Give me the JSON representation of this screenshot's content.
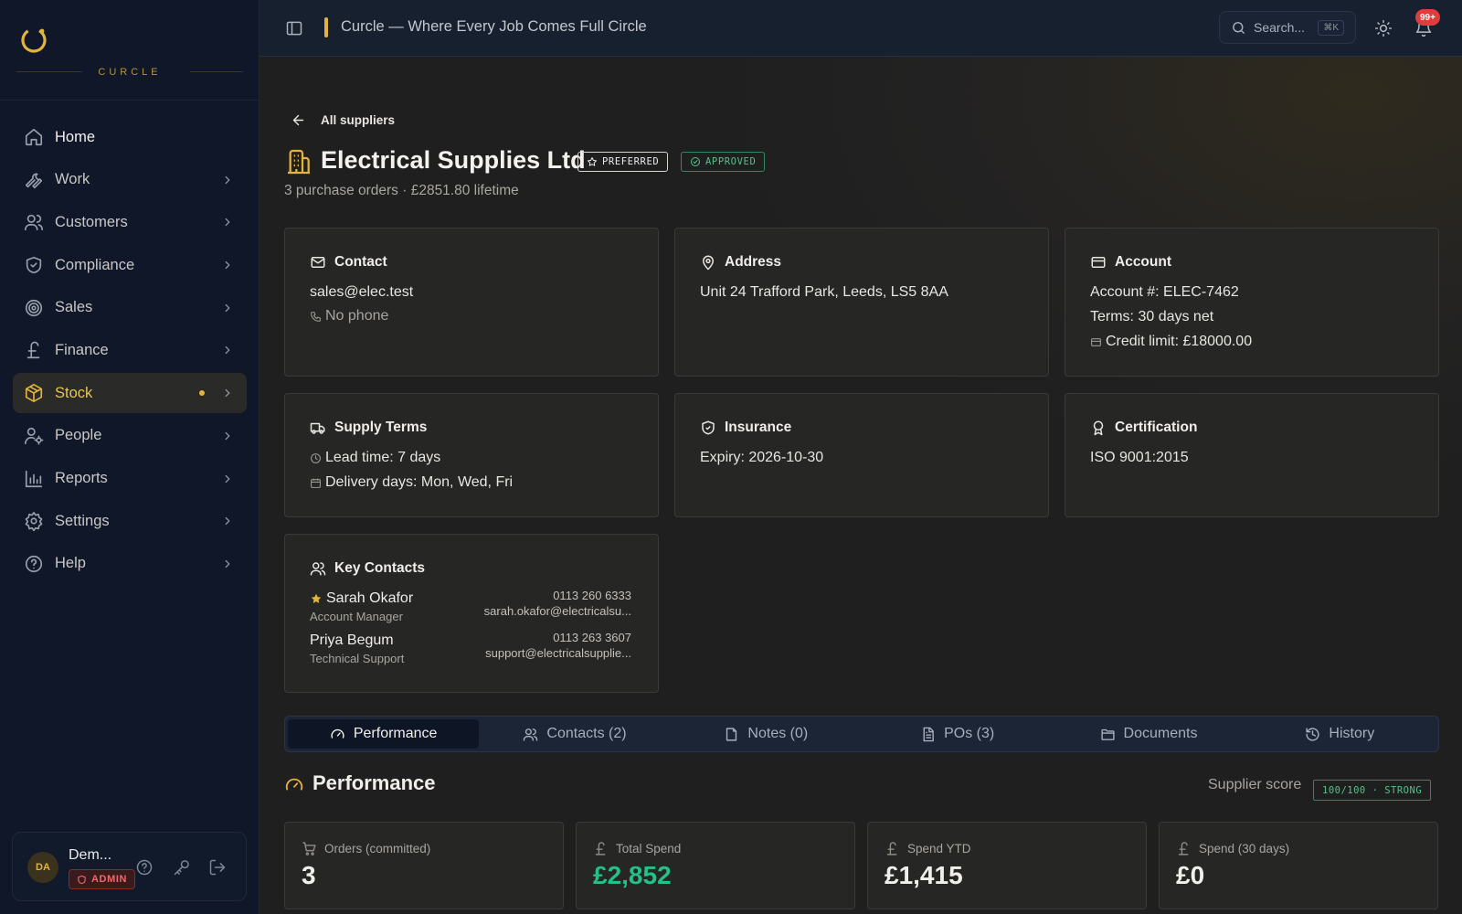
{
  "app": {
    "wordmark": "CURCLE",
    "topbar_title": "Curcle — Where Every Job Comes Full Circle",
    "search_placeholder": "Search...",
    "search_shortcut": "⌘K",
    "notification_count": "99+",
    "accent_color": "#e2b43c"
  },
  "sidebar": {
    "items": [
      {
        "label": "Home",
        "icon": "home-icon"
      },
      {
        "label": "Work",
        "icon": "wrench-icon"
      },
      {
        "label": "Customers",
        "icon": "users-icon"
      },
      {
        "label": "Compliance",
        "icon": "shield-icon"
      },
      {
        "label": "Sales",
        "icon": "target-icon"
      },
      {
        "label": "Finance",
        "icon": "pound-icon"
      },
      {
        "label": "Stock",
        "icon": "box-icon",
        "active": true
      },
      {
        "label": "People",
        "icon": "person-cog-icon"
      },
      {
        "label": "Reports",
        "icon": "bar-chart-icon"
      },
      {
        "label": "Settings",
        "icon": "gear-icon"
      },
      {
        "label": "Help",
        "icon": "help-circle-icon"
      }
    ]
  },
  "user": {
    "initials": "DA",
    "name": "Dem...",
    "role": "ADMIN"
  },
  "page": {
    "back_label": "All suppliers",
    "title": "Electrical Supplies Ltd",
    "badge_preferred": "PREFERRED",
    "badge_approved": "APPROVED",
    "subtitle": "3 purchase orders · £2851.80 lifetime"
  },
  "cards": {
    "contact": {
      "title": "Contact",
      "email": "sales@elec.test",
      "phone": "No phone"
    },
    "address": {
      "title": "Address",
      "value": "Unit 24 Trafford Park, Leeds, LS5 8AA"
    },
    "account": {
      "title": "Account",
      "number": "Account #: ELEC-7462",
      "terms": "Terms: 30 days net",
      "credit": "Credit limit: £18000.00"
    },
    "supply": {
      "title": "Supply Terms",
      "lead": "Lead time: 7 days",
      "delivery": "Delivery days: Mon, Wed, Fri"
    },
    "insurance": {
      "title": "Insurance",
      "expiry": "Expiry: 2026-10-30"
    },
    "certification": {
      "title": "Certification",
      "value": "ISO 9001:2015"
    },
    "key_contacts": {
      "title": "Key Contacts",
      "people": [
        {
          "name": "Sarah Okafor",
          "role": "Account Manager",
          "phone": "0113 260 6333",
          "email": "sarah.okafor@electricalsu...",
          "primary": true
        },
        {
          "name": "Priya Begum",
          "role": "Technical Support",
          "phone": "0113 263 3607",
          "email": "support@electricalsupplie...",
          "primary": false
        }
      ]
    }
  },
  "tabs": [
    {
      "label": "Performance",
      "icon": "gauge-icon",
      "active": true
    },
    {
      "label": "Contacts (2)",
      "icon": "users-icon"
    },
    {
      "label": "Notes (0)",
      "icon": "note-icon"
    },
    {
      "label": "POs (3)",
      "icon": "document-icon"
    },
    {
      "label": "Documents",
      "icon": "folder-icon"
    },
    {
      "label": "History",
      "icon": "history-icon"
    }
  ],
  "performance": {
    "title": "Performance",
    "score_label": "Supplier score",
    "score_value": "100/100 · STRONG",
    "stats": [
      {
        "label": "Orders (committed)",
        "value": "3",
        "icon": "cart-icon"
      },
      {
        "label": "Total Spend",
        "value": "£2,852",
        "icon": "pound-icon"
      },
      {
        "label": "Spend YTD",
        "value": "£1,415",
        "icon": "pound-icon"
      },
      {
        "label": "Spend (30 days)",
        "value": "£0",
        "icon": "pound-icon"
      }
    ]
  }
}
